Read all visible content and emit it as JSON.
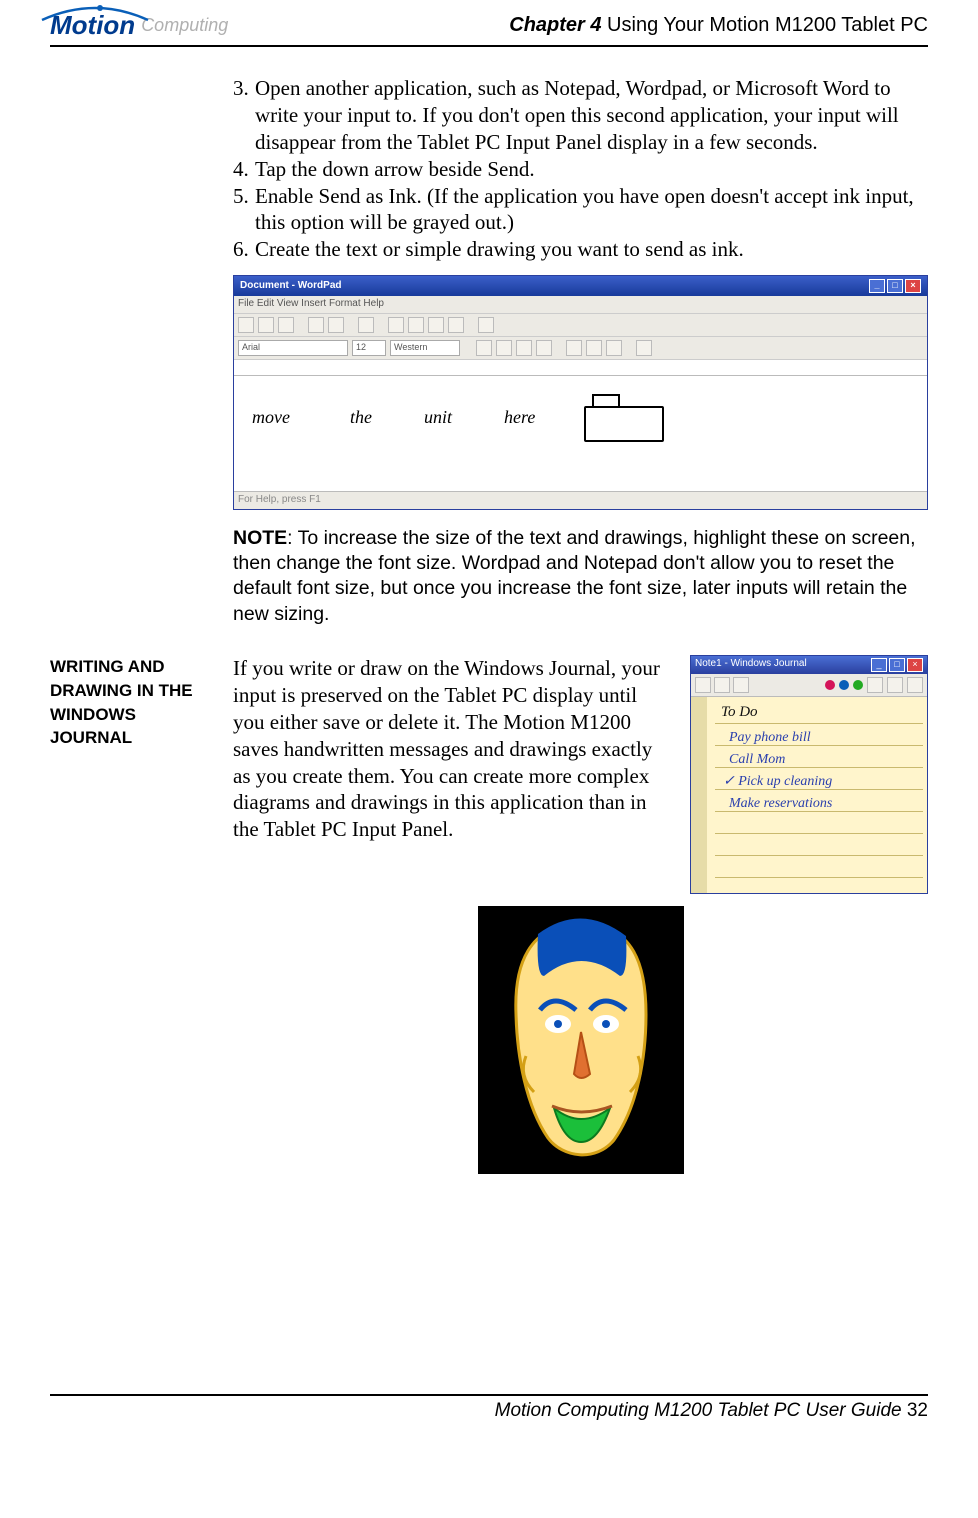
{
  "header": {
    "logo_main": "Motion",
    "logo_sub": "Computing",
    "chapter_label": "Chapter 4",
    "chapter_title": " Using Your Motion M1200 Tablet PC"
  },
  "steps": {
    "s3": "Open another application, such as Notepad, Wordpad, or Microsoft Word to write your input to. If you don't open this second application, your input will disappear from the Tablet PC Input Panel display in a few seconds.",
    "s4": "Tap the down arrow beside Send.",
    "s5": "Enable Send as Ink. (If the application you have open doesn't accept ink input, this option will be grayed out.)",
    "s6": "Create the text or simple drawing you want to send as ink."
  },
  "wordpad": {
    "title": "Document - WordPad",
    "menu": "File  Edit  View  Insert  Format  Help",
    "font": "Arial",
    "fontsize": "12",
    "script": "Western",
    "status": "For Help, press F1",
    "ink_words": [
      "move",
      "the",
      "unit",
      "here"
    ]
  },
  "note": {
    "label": "NOTE",
    "body": ": To increase the size of the text and drawings, highlight these on screen, then change the font size. Wordpad and Notepad don't allow you to reset the default font size, but once you increase the font size, later inputs will retain the new sizing."
  },
  "sidebar": {
    "heading_line1": "WRITING AND",
    "heading_line2": "DRAWING IN",
    "heading_line3": "THE WINDOWS",
    "heading_line4": "JOURNAL"
  },
  "journal": {
    "paragraph": "If you write or draw on the Windows Journal, your input is preserved on the Tablet PC display until you either save or delete it. The Motion M1200 saves handwritten messages and drawings exactly as you create them. You can create more complex diagrams and drawings in this application than in the Tablet PC Input Panel.",
    "title": "Note1 - Windows Journal",
    "todo_title": "To Do",
    "items": [
      "Pay phone bill",
      "Call Mom",
      "Pick up cleaning",
      "Make reservations"
    ]
  },
  "footer": {
    "text": "Motion Computing M1200 Tablet PC User Guide",
    "page": " 32"
  }
}
